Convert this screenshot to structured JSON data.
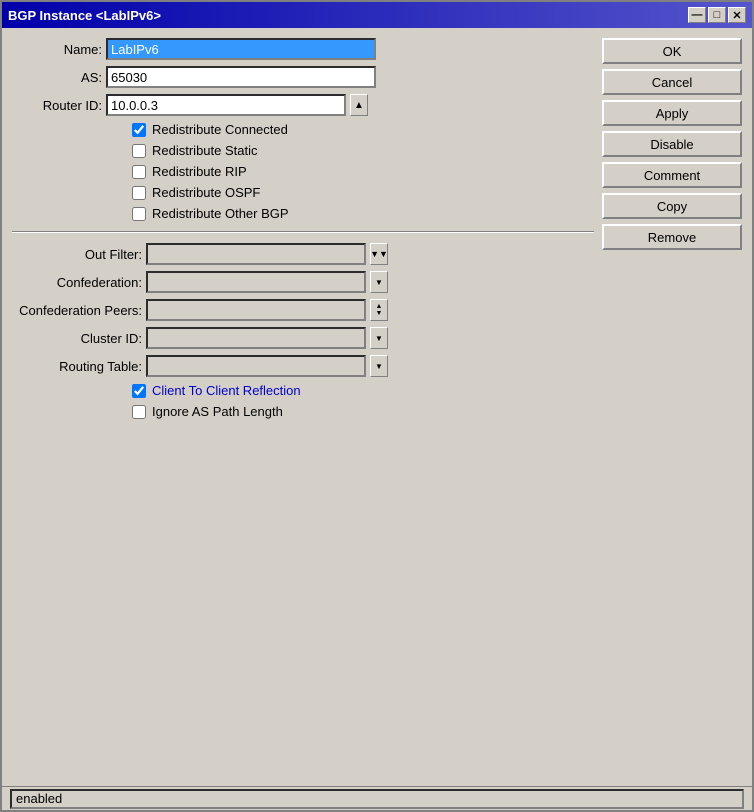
{
  "window": {
    "title": "BGP Instance <LabIPv6>",
    "title_btn_minimize": "—",
    "title_btn_restore": "□",
    "title_btn_close": "✕"
  },
  "form": {
    "name_label": "Name:",
    "name_value": "LabIPv6",
    "as_label": "AS:",
    "as_value": "65030",
    "router_id_label": "Router ID:",
    "router_id_value": "10.0.0.3"
  },
  "checkboxes": {
    "redistribute_connected_label": "Redistribute Connected",
    "redistribute_connected_checked": true,
    "redistribute_static_label": "Redistribute Static",
    "redistribute_static_checked": false,
    "redistribute_rip_label": "Redistribute RIP",
    "redistribute_rip_checked": false,
    "redistribute_ospf_label": "Redistribute OSPF",
    "redistribute_ospf_checked": false,
    "redistribute_other_bgp_label": "Redistribute Other BGP",
    "redistribute_other_bgp_checked": false,
    "client_to_client_label": "Client To Client Reflection",
    "client_to_client_checked": true,
    "ignore_as_path_label": "Ignore AS Path Length",
    "ignore_as_path_checked": false
  },
  "combos": {
    "out_filter_label": "Out Filter:",
    "out_filter_value": "",
    "confederation_label": "Confederation:",
    "confederation_value": "",
    "confederation_peers_label": "Confederation Peers:",
    "confederation_peers_value": "",
    "cluster_id_label": "Cluster ID:",
    "cluster_id_value": "",
    "routing_table_label": "Routing Table:",
    "routing_table_value": ""
  },
  "buttons": {
    "ok": "OK",
    "cancel": "Cancel",
    "apply": "Apply",
    "disable": "Disable",
    "comment": "Comment",
    "copy": "Copy",
    "remove": "Remove"
  },
  "status": {
    "text": "enabled"
  },
  "icons": {
    "dropdown_arrow": "▼",
    "spin_up": "▲",
    "spin_up_down": "▲▼",
    "out_filter_special": "▼"
  }
}
